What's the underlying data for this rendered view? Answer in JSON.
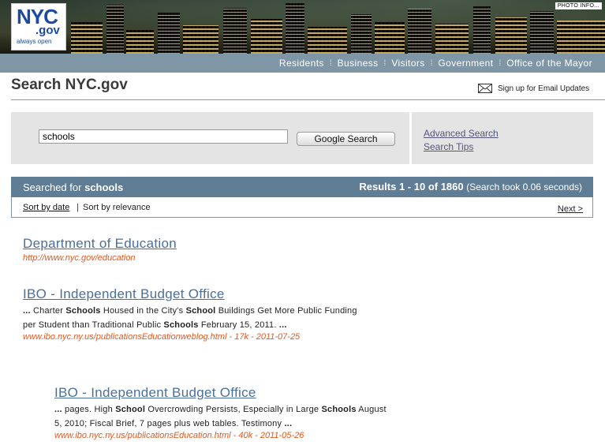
{
  "header": {
    "logo": {
      "nyc": "NYC",
      "gov": ".gov",
      "tagline": "always open"
    },
    "photo_info": "PHOTO INFO...",
    "nav": [
      "Residents",
      "Business",
      "Visitors",
      "Government",
      "Office of the Mayor"
    ]
  },
  "page_title": "Search NYC.gov",
  "email_signup": "Sign up for Email Updates",
  "search": {
    "query": "schools",
    "button": "Google Search",
    "advanced": "Advanced Search",
    "tips": "Search Tips"
  },
  "results_bar": {
    "searched_prefix": "Searched for",
    "term": "schools",
    "count": "Results 1 - 10 of 1860",
    "took": "(Search took 0.06 seconds)"
  },
  "sort": {
    "by_date": "Sort by date",
    "separator": "|",
    "by_relevance": "Sort by relevance",
    "next": "Next >"
  },
  "results": [
    {
      "title": "Department of Education",
      "snippet1": "",
      "snippet2": "",
      "url": "http://www.nyc.gov/education"
    },
    {
      "title": "IBO - Independent Budget Office",
      "url": "www.ibo.nyc.ny.us/publicationsEducationweblog.html - 17k - 2011-07-25"
    },
    {
      "title": "IBO - Independent Budget Office",
      "url": "www.ibo.nyc.ny.us/publicationsEducation.html - 40k - 2011-05-26"
    }
  ],
  "snippets": {
    "r2_l1": [
      {
        "t": "... ",
        "b": true
      },
      {
        "t": "Charter ",
        "b": false
      },
      {
        "t": "Schools",
        "b": true
      },
      {
        "t": " Housed in the City's ",
        "b": false
      },
      {
        "t": "School",
        "b": true
      },
      {
        "t": " Buildings Get More Public Funding",
        "b": false
      }
    ],
    "r2_l2": [
      {
        "t": "per Student than Traditional Public ",
        "b": false
      },
      {
        "t": "Schools",
        "b": true
      },
      {
        "t": " February 15, 2011. ",
        "b": false
      },
      {
        "t": "...",
        "b": true
      }
    ],
    "r3_l1": [
      {
        "t": "...",
        "b": true
      },
      {
        "t": " pages. High ",
        "b": false
      },
      {
        "t": "School",
        "b": true
      },
      {
        "t": " Overcrowding Persists, Especially in Large ",
        "b": false
      },
      {
        "t": "Schools",
        "b": true
      },
      {
        "t": " August",
        "b": false
      }
    ],
    "r3_l2": [
      {
        "t": "5, 2010; Fiscal Brief, 7 pages plus web tables. Testimony ",
        "b": false
      },
      {
        "t": "...",
        "b": true
      }
    ]
  },
  "colors": {
    "nav_bar": "#7e96a6",
    "results_bar": "#5f7d95",
    "link": "#4a6f9a",
    "url": "#e3571e"
  }
}
